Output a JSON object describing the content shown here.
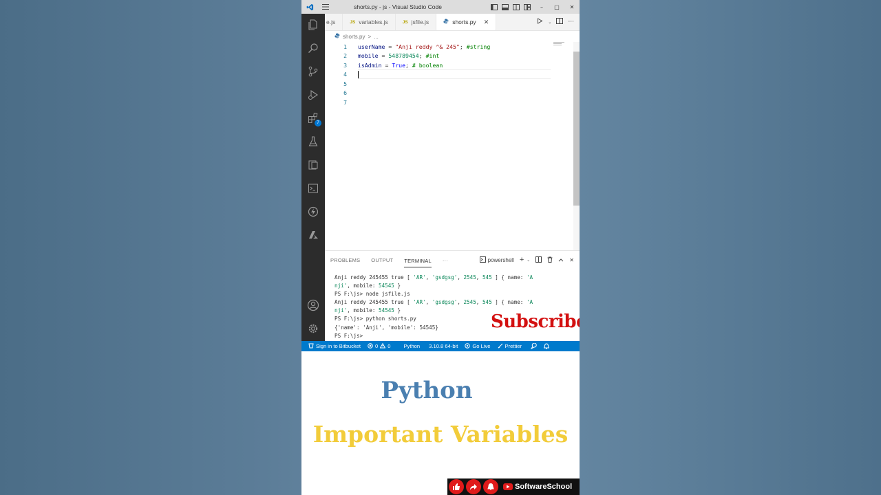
{
  "window": {
    "title": "shorts.py - js - Visual Studio Code"
  },
  "tabs": [
    {
      "label": "e.js",
      "type": "js"
    },
    {
      "label": "variables.js",
      "type": "js",
      "icon": "JS"
    },
    {
      "label": "jsfile.js",
      "type": "js",
      "icon": "JS"
    },
    {
      "label": "shorts.py",
      "type": "py",
      "active": true
    }
  ],
  "breadcrumb": {
    "file": "shorts.py",
    "sep": ">",
    "rest": "..."
  },
  "editor": {
    "line_numbers": [
      "1",
      "2",
      "3",
      "4",
      "5",
      "6",
      "7"
    ],
    "line1": {
      "a": "userName",
      "b": " = ",
      "c": "\"Anji reddy ^& 245\"",
      "d": "; ",
      "e": "#string"
    },
    "line2": {
      "a": "mobile",
      "b": " = ",
      "c": "548789454",
      "d": "; ",
      "e": "#int"
    },
    "line3": {
      "a": "isAdmin",
      "b": " = ",
      "c": "True",
      "d": "; ",
      "e": "# boolean"
    }
  },
  "activity": {
    "extensions_badge": "7"
  },
  "panel": {
    "tabs": [
      "PROBLEMS",
      "OUTPUT",
      "TERMINAL",
      "···"
    ],
    "shell": "powershell",
    "terminal": {
      "l1a": "Anji reddy 245455 true [ ",
      "l1b": "'AR'",
      "l1c": ", ",
      "l1d": "'gsdgsg'",
      "l1e": ", ",
      "l1f": "2545",
      "l1g": ", ",
      "l1h": "545",
      "l1i": " ] { name: ",
      "l1j": "'A",
      "l2a": "nji'",
      "l2b": ", mobile: ",
      "l2c": "54545",
      "l2d": " }",
      "l3": "PS F:\\js> node jsfile.js",
      "l6": "PS F:\\js> python shorts.py",
      "l7": "{'name': 'Anji', 'mobile': 54545}",
      "l8": "PS F:\\js> "
    },
    "subscribe": "Subscribe"
  },
  "status": {
    "bitbucket": "Sign in to Bitbucket",
    "errors": "0",
    "warnings": "0",
    "language": "Python",
    "interpreter": "3.10.8 64-bit",
    "golive": "Go Live",
    "prettier": "Prettier"
  },
  "caption": {
    "line1": "Python",
    "line2": "Important Variables",
    "brand": "SoftwareSchool"
  },
  "colors": {
    "accent": "#007acc",
    "activity_bg": "#2c2c2c",
    "subscribe": "#d31010",
    "caption1": "#4a7fb0",
    "caption2": "#f2cc3a"
  }
}
